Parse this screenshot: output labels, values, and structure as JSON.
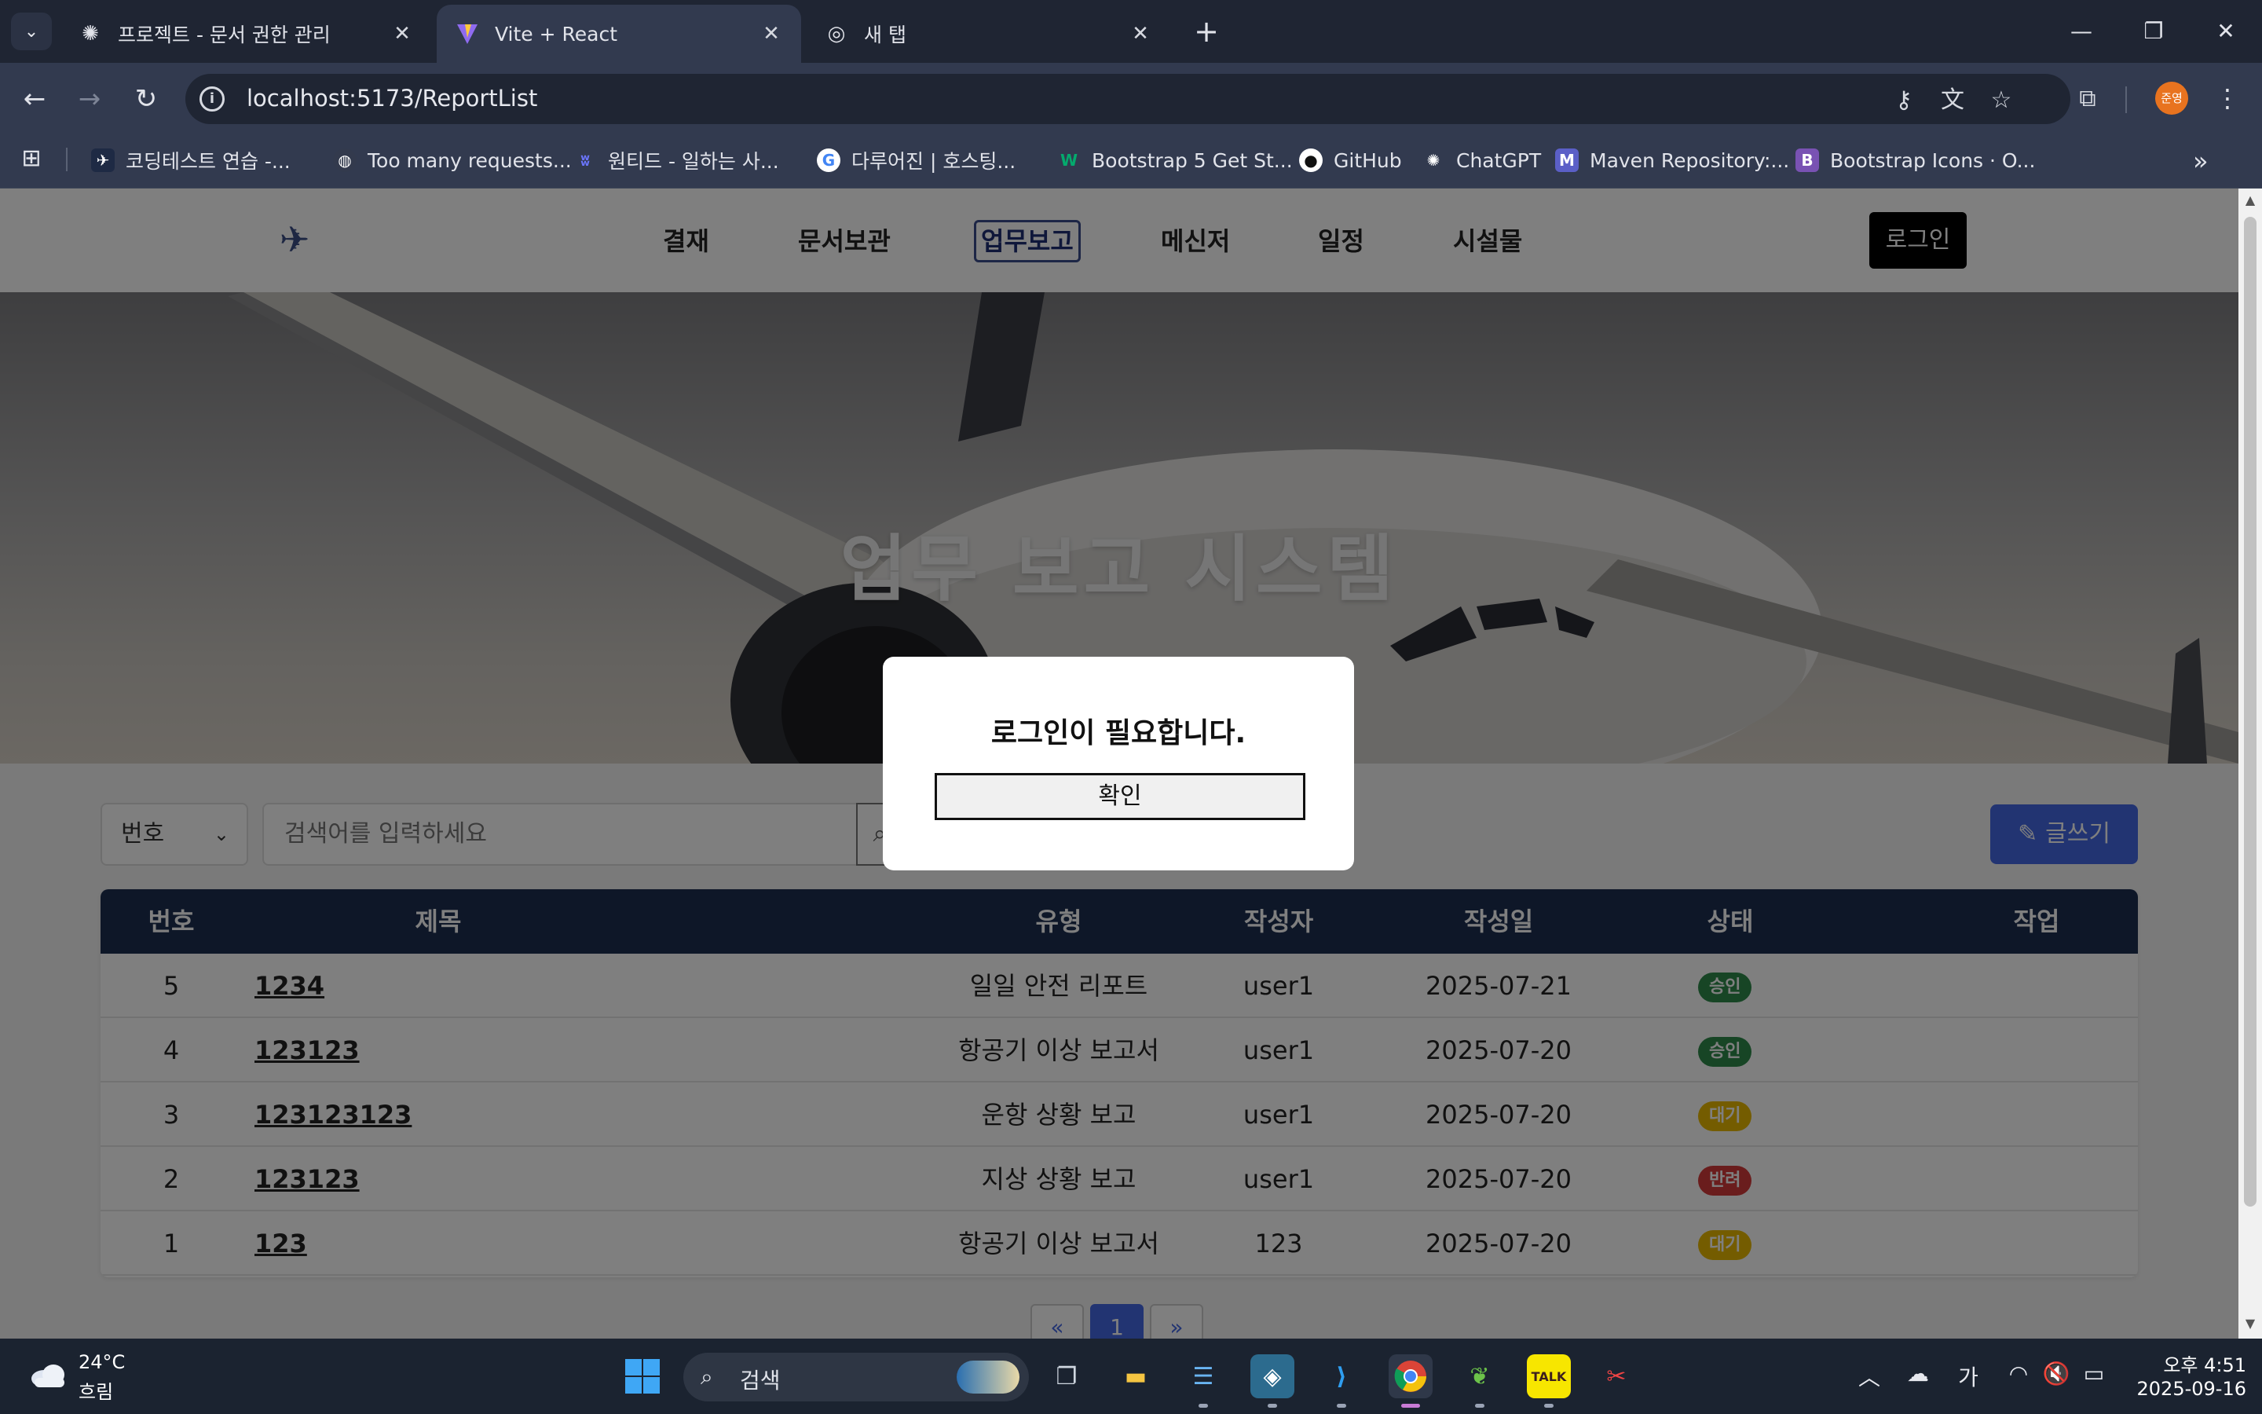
{
  "browser": {
    "tabs": [
      {
        "title": "프로젝트 - 문서 권한 관리",
        "icon": "openai-icon",
        "active": false
      },
      {
        "title": "Vite + React",
        "icon": "vite-icon",
        "active": true
      },
      {
        "title": "새 탭",
        "icon": "chrome-icon",
        "active": false
      }
    ],
    "url": "localhost:5173/ReportList",
    "profile_initials": "준영",
    "bookmarks": [
      {
        "label": "코딩테스트 연습 -...",
        "icon": "bird-icon",
        "color": "#1e2a44"
      },
      {
        "label": "Too many requests...",
        "icon": "globe-icon",
        "color": "#333a4d"
      },
      {
        "label": "원티드 - 일하는 사...",
        "icon": "wanted-icon",
        "color": "#3a3fd6"
      },
      {
        "label": "다루어진 | 호스팅...",
        "icon": "google-icon",
        "color": "#ffffff"
      },
      {
        "label": "Bootstrap 5 Get St...",
        "icon": "w3-icon",
        "color": "#04aa6d"
      },
      {
        "label": "GitHub",
        "icon": "github-icon",
        "color": "#ffffff"
      },
      {
        "label": "ChatGPT",
        "icon": "openai-icon",
        "color": "#ffffff"
      },
      {
        "label": "Maven Repository:...",
        "icon": "maven-icon",
        "color": "#5b5fc7"
      },
      {
        "label": "Bootstrap Icons · O...",
        "icon": "bootstrap-icon",
        "color": "#7952b3"
      }
    ]
  },
  "site": {
    "nav": [
      "결재",
      "문서보관",
      "업무보고",
      "메신저",
      "일정",
      "시설물"
    ],
    "active_nav": "업무보고",
    "login_label": "로그인",
    "hero_title": "업무 보고 시스템"
  },
  "search": {
    "select_value": "번호",
    "placeholder": "검색어를 입력하세요",
    "write_label": "글쓰기"
  },
  "table": {
    "headers": [
      "번호",
      "제목",
      "유형",
      "작성자",
      "작성일",
      "상태",
      "작업"
    ],
    "rows": [
      {
        "no": "5",
        "title": "1234",
        "type": "일일 안전 리포트",
        "author": "user1",
        "date": "2025-07-21",
        "status": "승인"
      },
      {
        "no": "4",
        "title": "123123",
        "type": "항공기 이상 보고서",
        "author": "user1",
        "date": "2025-07-20",
        "status": "승인"
      },
      {
        "no": "3",
        "title": "123123123",
        "type": "운항 상황 보고",
        "author": "user1",
        "date": "2025-07-20",
        "status": "대기"
      },
      {
        "no": "2",
        "title": "123123",
        "type": "지상 상황 보고",
        "author": "user1",
        "date": "2025-07-20",
        "status": "반려"
      },
      {
        "no": "1",
        "title": "123",
        "type": "항공기 이상 보고서",
        "author": "123",
        "date": "2025-07-20",
        "status": "대기"
      }
    ],
    "status_colors": {
      "승인": "#2e8a4a",
      "대기": "#e8b800",
      "반려": "#d43a3a"
    }
  },
  "pagination": {
    "prev": "«",
    "current": "1",
    "next": "»"
  },
  "modal": {
    "message": "로그인이 필요합니다.",
    "confirm_label": "확인"
  },
  "taskbar": {
    "weather_temp": "24°C",
    "weather_cond": "흐림",
    "search_label": "검색",
    "ime": "가",
    "time": "오후 4:51",
    "date": "2025-09-16"
  }
}
